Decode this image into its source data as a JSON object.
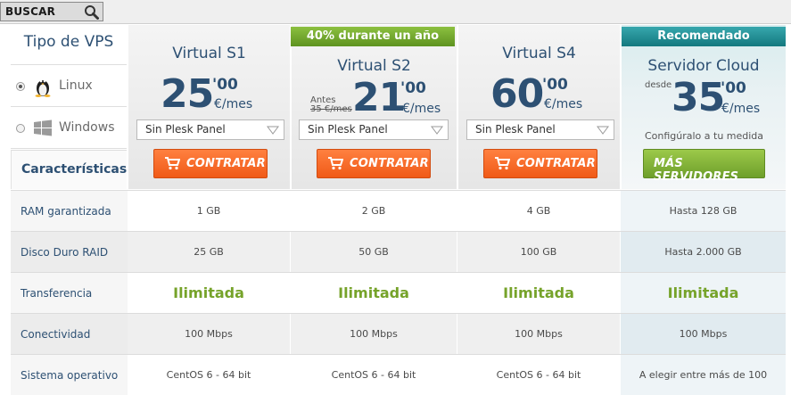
{
  "search": {
    "label": "BUSCAR",
    "icon": "search-icon"
  },
  "vps_type": {
    "title": "Tipo de VPS",
    "options": [
      {
        "label": "Linux",
        "icon": "linux-penguin-icon",
        "selected": true
      },
      {
        "label": "Windows",
        "icon": "windows-logo-icon",
        "selected": false
      }
    ],
    "features_tab": "Características"
  },
  "plans": [
    {
      "name": "Virtual S1",
      "price_int": "25",
      "price_dec": "'00",
      "unit": "€/mes",
      "select": "Sin Plesk Panel",
      "button": "CONTRATAR"
    },
    {
      "name": "Virtual S2",
      "badge": "40% durante un año",
      "before_label": "Antes",
      "before_price": "35 €/mes",
      "price_int": "21",
      "price_dec": "'00",
      "unit": "€/mes",
      "select": "Sin Plesk Panel",
      "button": "CONTRATAR"
    },
    {
      "name": "Virtual S4",
      "price_int": "60",
      "price_dec": "'00",
      "unit": "€/mes",
      "select": "Sin Plesk Panel",
      "button": "CONTRATAR"
    },
    {
      "name": "Servidor Cloud",
      "badge": "Recomendado",
      "from_label": "desde",
      "price_int": "35",
      "price_dec": "'00",
      "unit": "€/mes",
      "note": "Configúralo a tu medida",
      "button": "MÁS SERVIDORES"
    }
  ],
  "table": {
    "rows": [
      {
        "label": "RAM garantizada",
        "values": [
          "1 GB",
          "2 GB",
          "4 GB",
          "Hasta 128 GB"
        ]
      },
      {
        "label": "Disco Duro RAID",
        "values": [
          "25 GB",
          "50 GB",
          "100 GB",
          "Hasta 2.000 GB"
        ]
      },
      {
        "label": "Transferencia",
        "values": [
          "Ilimitada",
          "Ilimitada",
          "Ilimitada",
          "Ilimitada"
        ]
      },
      {
        "label": "Conectividad",
        "values": [
          "100 Mbps",
          "100 Mbps",
          "100 Mbps",
          "100 Mbps"
        ]
      },
      {
        "label": "Sistema operativo",
        "values": [
          "CentOS 6 - 64 bit",
          "CentOS 6 - 64 bit",
          "CentOS 6 - 64 bit",
          "A elegir entre más de 100"
        ]
      }
    ]
  },
  "colors": {
    "heading_blue": "#2d5073",
    "orange_button": "#f05a17",
    "green_accent": "#76a32a",
    "teal_badge": "#13797f"
  }
}
